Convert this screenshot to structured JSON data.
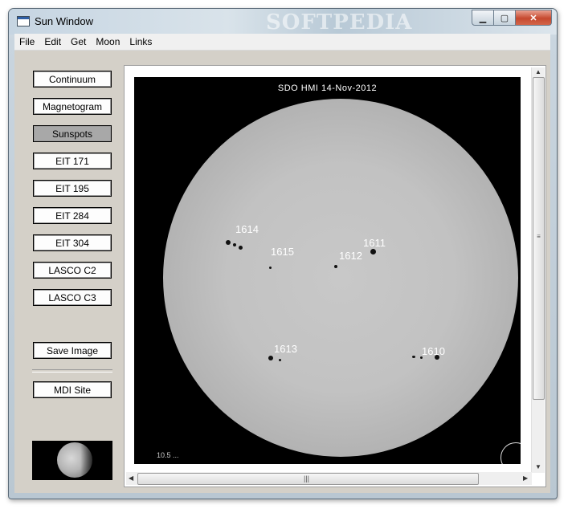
{
  "window": {
    "title": "Sun Window",
    "watermark": "SOFTPEDIA",
    "controls": {
      "minimize": "▁",
      "maximize": "▢",
      "close": "✕"
    }
  },
  "menu": [
    "File",
    "Edit",
    "Get",
    "Moon",
    "Links"
  ],
  "buttons": {
    "continuum": "Continuum",
    "magnetogram": "Magnetogram",
    "sunspots": "Sunspots",
    "eit171": "EIT 171",
    "eit195": "EIT 195",
    "eit284": "EIT 284",
    "eit304": "EIT 304",
    "lasco_c2": "LASCO C2",
    "lasco_c3": "LASCO C3",
    "save_image": "Save Image",
    "mdi_site": "MDI Site"
  },
  "selected_view": "Sunspots",
  "image": {
    "title": "SDO HMI   14-Nov-2012",
    "caption": "10.5 ...",
    "regions": [
      "1614",
      "1615",
      "1612",
      "1611",
      "1613",
      "1610"
    ]
  },
  "colors": {
    "panel": "#d4d0c8",
    "pressed_button": "#a8a8a8",
    "image_background": "#000000"
  }
}
